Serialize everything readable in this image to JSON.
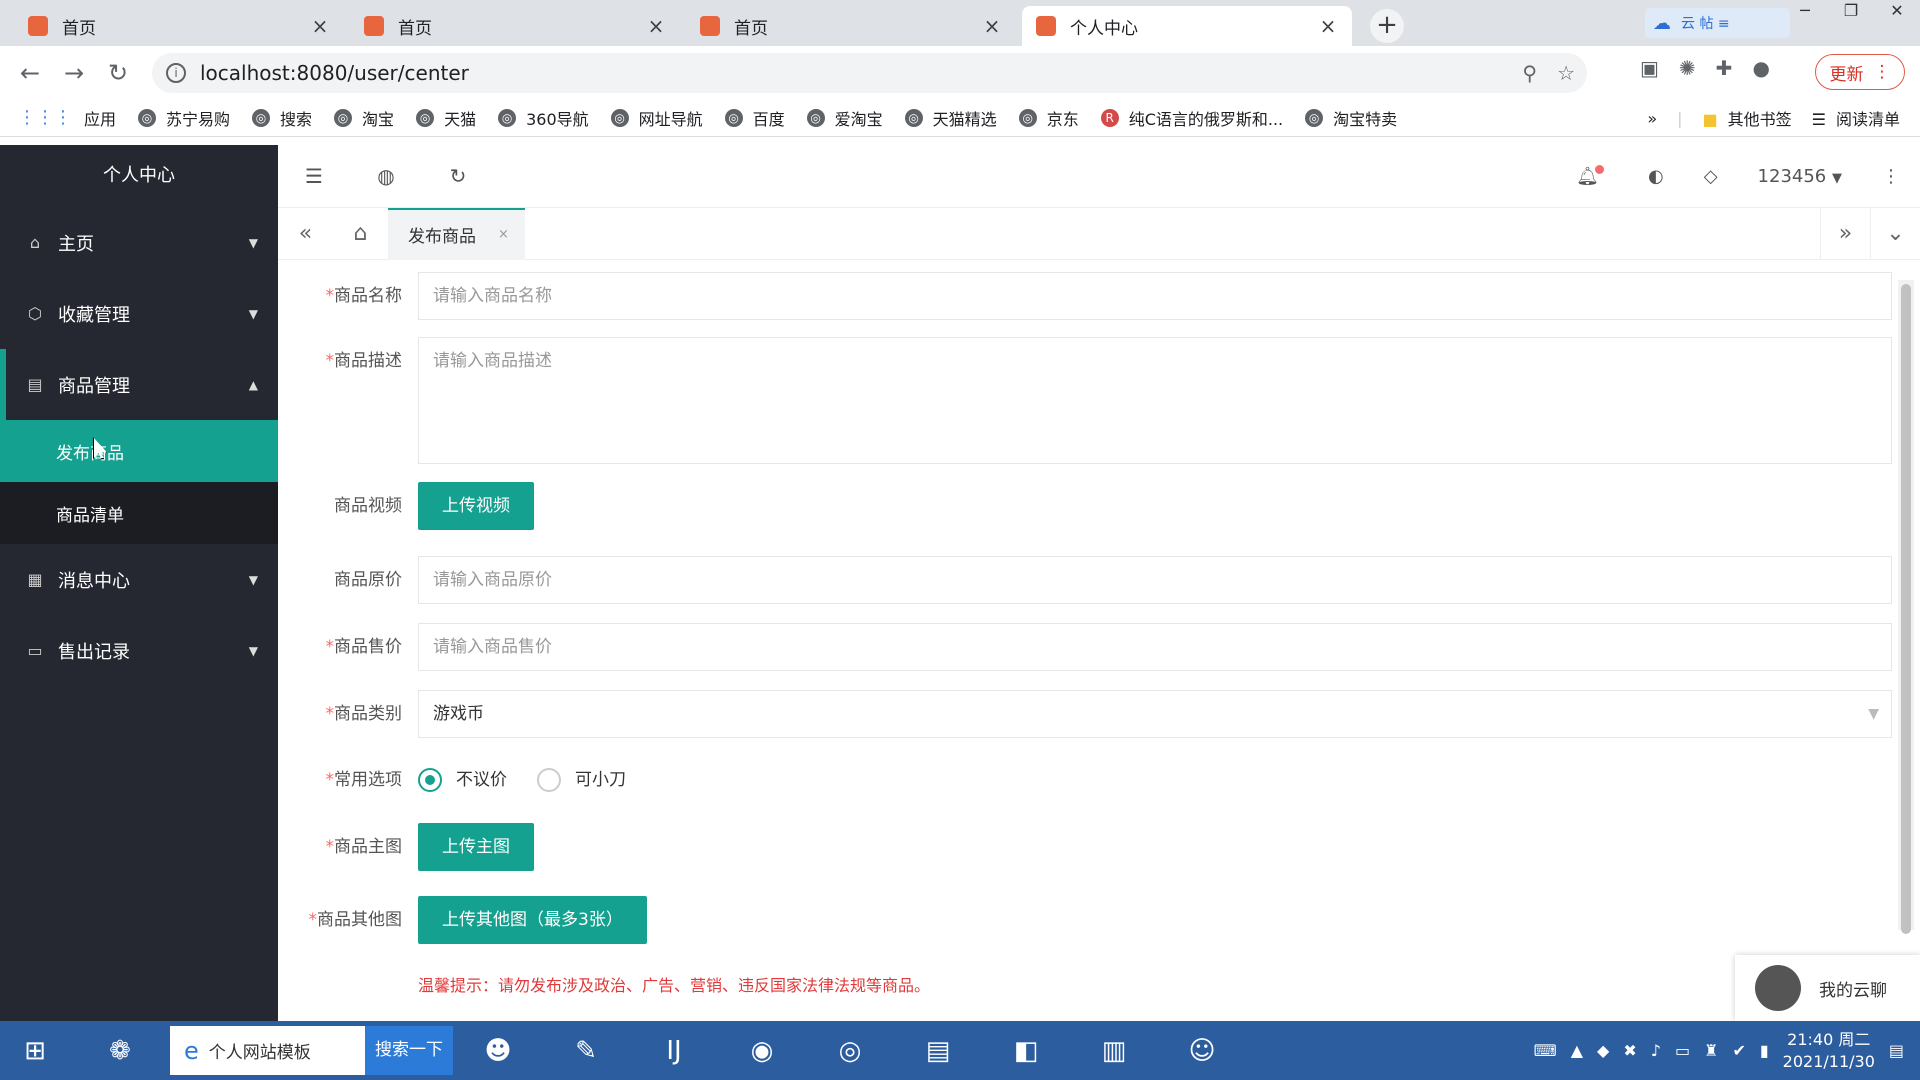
{
  "browser": {
    "tabs": [
      {
        "title": "首页",
        "close": "×"
      },
      {
        "title": "首页",
        "close": "×"
      },
      {
        "title": "首页",
        "close": "×"
      },
      {
        "title": "个人中心",
        "close": "×"
      }
    ],
    "new_tab": "+",
    "cloud_label": "云 帖 ≡",
    "url": "localhost:8080/user/center",
    "update_label": "更新",
    "bookmarks": [
      "应用",
      "苏宁易购",
      "搜索",
      "淘宝",
      "天猫",
      "360导航",
      "网址导航",
      "百度",
      "爱淘宝",
      "天猫精选",
      "京东",
      "纯C语言的俄罗斯和...",
      "淘宝特卖"
    ],
    "bookmarks_overflow": "»",
    "other_bookmarks": "其他书签",
    "reading_list": "阅读清单"
  },
  "sidebar": {
    "title": "个人中心",
    "items": [
      {
        "label": "主页",
        "icon": "home-icon"
      },
      {
        "label": "收藏管理",
        "icon": "box-icon"
      },
      {
        "label": "商品管理",
        "icon": "list-icon"
      },
      {
        "label": "消息中心",
        "icon": "grid-icon"
      },
      {
        "label": "售出记录",
        "icon": "doc-icon"
      }
    ],
    "sub_items": [
      "发布商品",
      "商品清单"
    ]
  },
  "header": {
    "username": "123456"
  },
  "page_tab": {
    "label": "发布商品",
    "close": "×"
  },
  "form": {
    "name_label": "商品名称",
    "name_placeholder": "请输入商品名称",
    "desc_label": "商品描述",
    "desc_placeholder": "请输入商品描述",
    "video_label": "商品视频",
    "video_button": "上传视频",
    "orig_price_label": "商品原价",
    "orig_price_placeholder": "请输入商品原价",
    "price_label": "商品售价",
    "price_placeholder": "请输入商品售价",
    "category_label": "商品类别",
    "category_value": "游戏币",
    "options_label": "常用选项",
    "option1": "不议价",
    "option2": "可小刀",
    "main_image_label": "商品主图",
    "main_image_button": "上传主图",
    "other_images_label": "商品其他图",
    "other_images_button": "上传其他图（最多3张）",
    "tip": "温馨提示：请勿发布涉及政治、广告、营销、违反国家法律法规等商品。"
  },
  "chat": {
    "label": "我的云聊"
  },
  "taskbar": {
    "search_text": "个人网站模板",
    "search_button": "搜索一下",
    "time": "21:40 周二",
    "date": "2021/11/30"
  }
}
